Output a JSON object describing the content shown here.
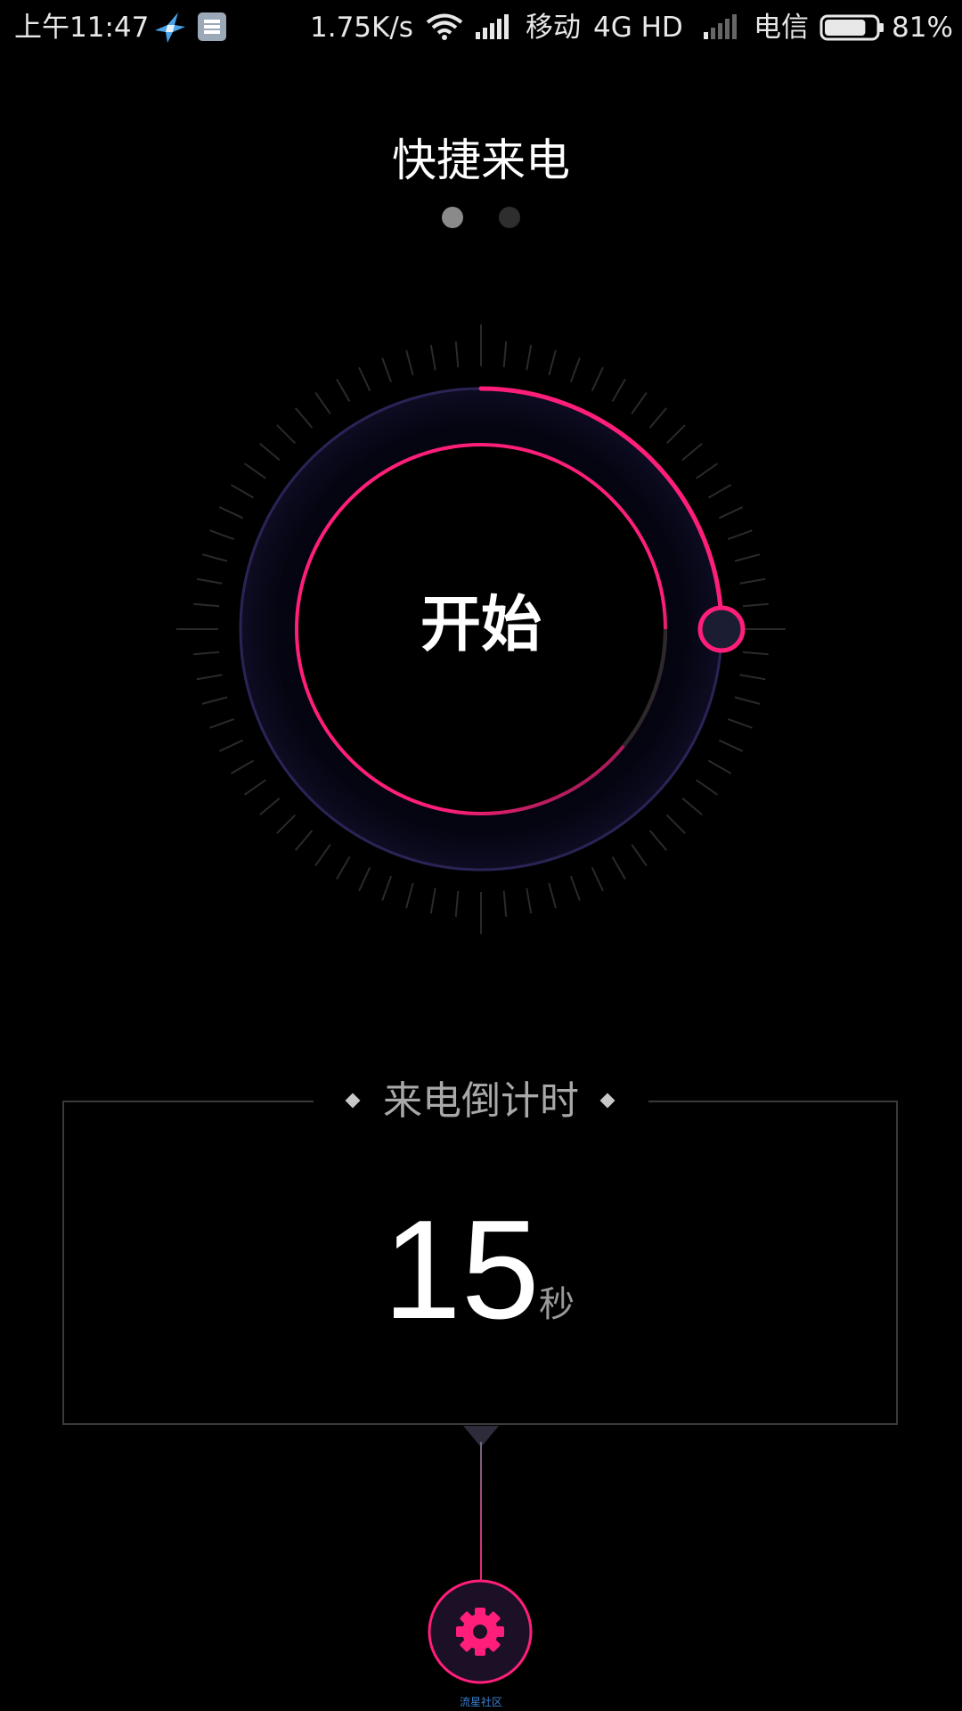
{
  "status_bar": {
    "time": "上午11:47",
    "net_speed": "1.75K/s",
    "carrier1": "移动",
    "network_type": "4G HD",
    "carrier2": "电信",
    "battery_percent": "81%",
    "battery_level": 0.81,
    "icons": [
      "bird-notification-icon",
      "storage-notification-icon",
      "wifi-icon",
      "signal-icon",
      "signal-weak-icon",
      "battery-icon"
    ]
  },
  "header": {
    "title": "快捷来电",
    "page_count": 2,
    "active_page": 0
  },
  "dial": {
    "label": "开始",
    "progress_fraction": 0.25,
    "accent_color": "#ff1f7a",
    "ring_color": "#2a2456"
  },
  "countdown": {
    "title": "来电倒计时",
    "value": "15",
    "unit": "秒"
  },
  "settings": {
    "icon": "gear-icon",
    "accent_color": "#ff1f7a"
  },
  "watermark": "流星社区"
}
